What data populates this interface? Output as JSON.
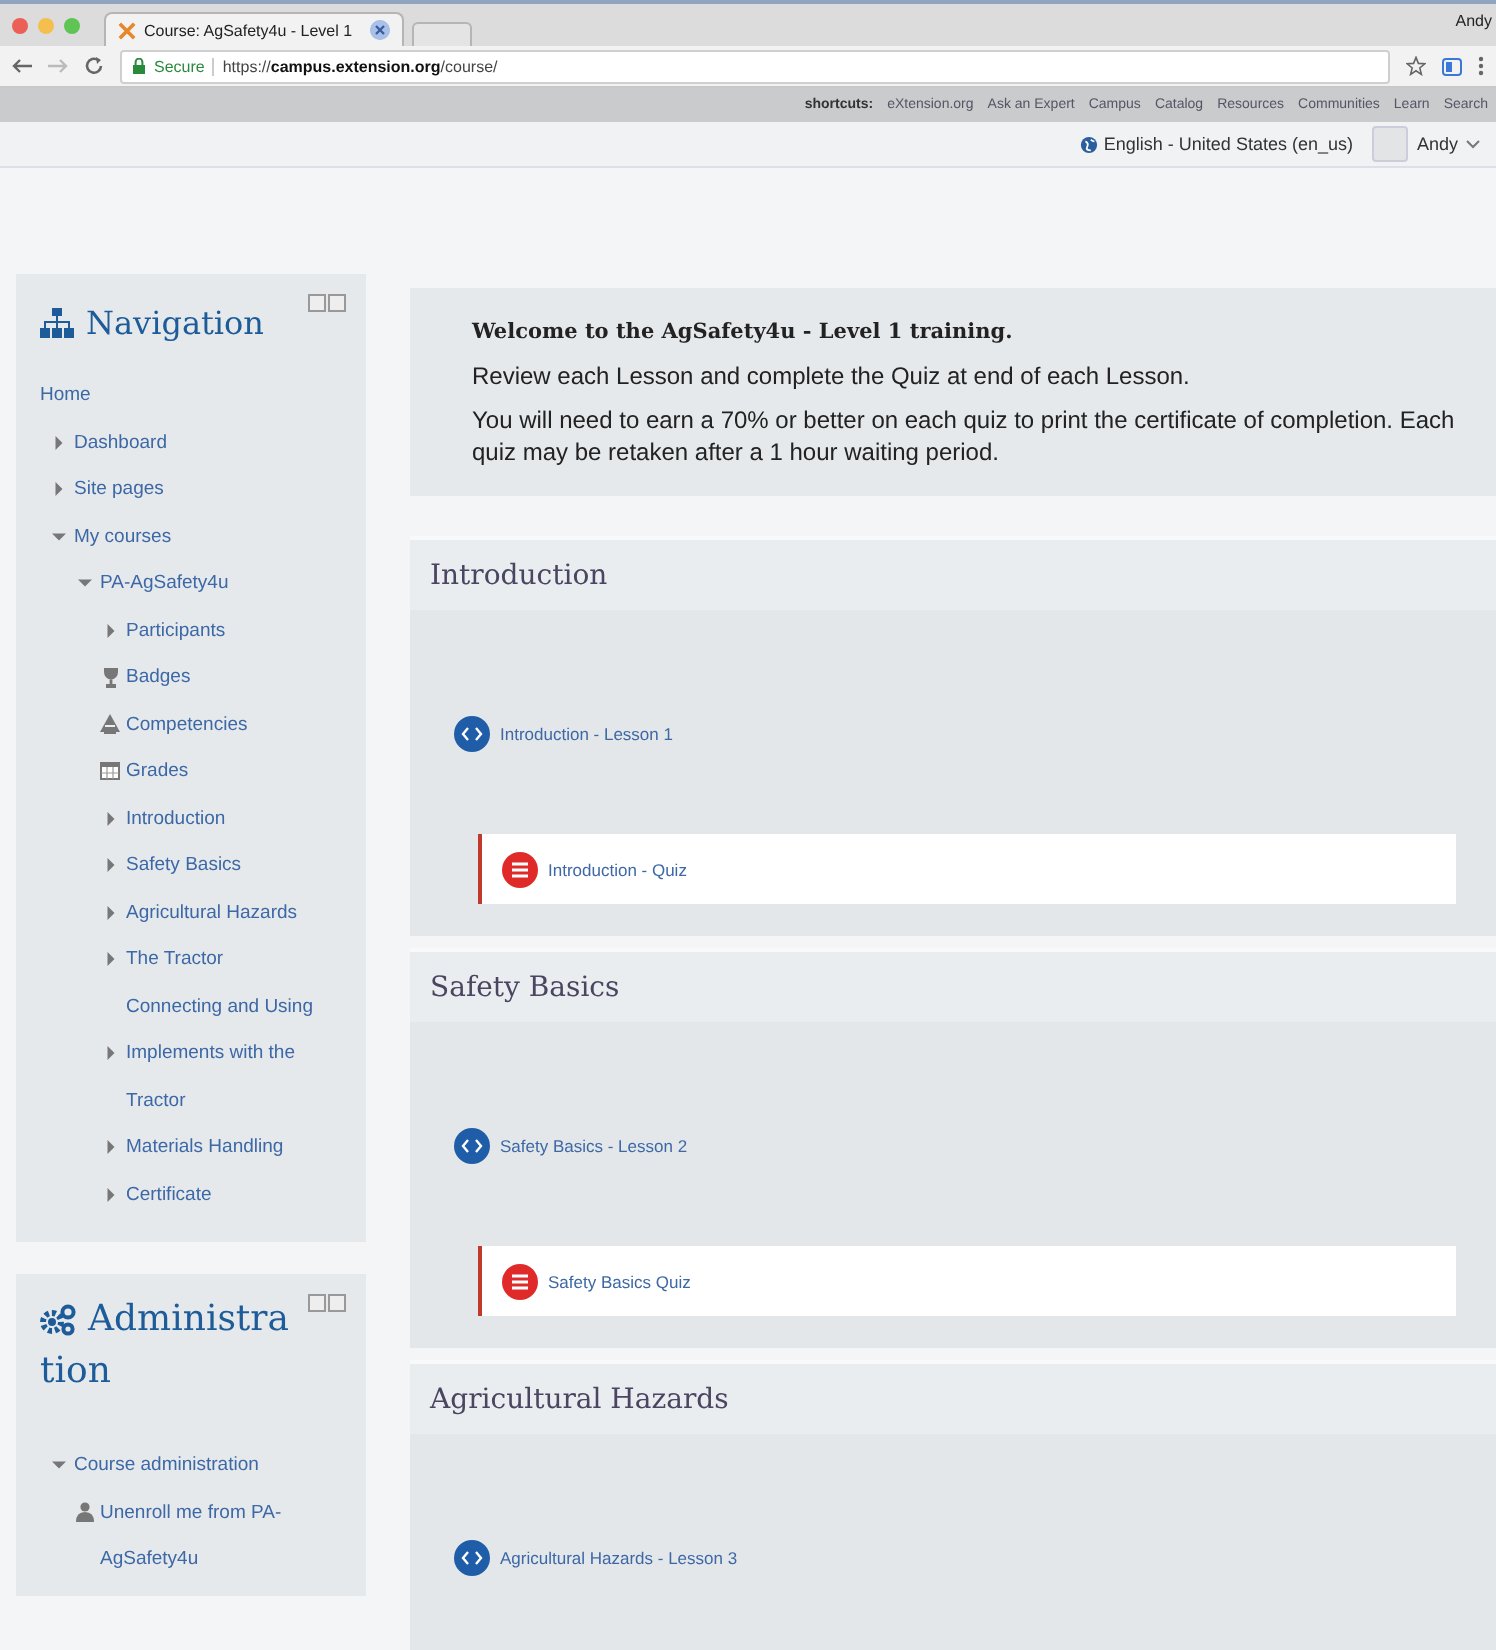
{
  "browser": {
    "tab_title": "Course: AgSafety4u - Level 1",
    "profile": "Andy",
    "secure_label": "Secure",
    "url": "https://**campus.extension.org**/course/"
  },
  "shortcuts": {
    "label": "shortcuts:",
    "links": [
      "eXtension.org",
      "Ask an Expert",
      "Campus",
      "Catalog",
      "Resources",
      "Communities",
      "Learn",
      "Search"
    ]
  },
  "user_bar": {
    "language": "English - United States (en_us)",
    "user": "Andy"
  },
  "navigation": {
    "title": "Navigation",
    "items": [
      {
        "kind": "link",
        "label": "Home"
      },
      {
        "kind": "node",
        "label": "Dashboard",
        "expanded": false
      },
      {
        "kind": "node",
        "label": "Site pages",
        "expanded": false
      },
      {
        "kind": "node",
        "label": "My courses",
        "expanded": true,
        "children": [
          {
            "kind": "node",
            "label": "PA-AgSafety4u",
            "expanded": true,
            "children": [
              {
                "kind": "node",
                "label": "Participants",
                "expanded": false
              },
              {
                "kind": "badge",
                "label": "Badges"
              },
              {
                "kind": "competency",
                "label": "Competencies"
              },
              {
                "kind": "grades",
                "label": "Grades"
              },
              {
                "kind": "node",
                "label": "Introduction",
                "expanded": false
              },
              {
                "kind": "node",
                "label": "Safety Basics",
                "expanded": false
              },
              {
                "kind": "node",
                "label": "Agricultural Hazards",
                "expanded": false
              },
              {
                "kind": "node",
                "label": "The Tractor",
                "expanded": false
              },
              {
                "kind": "text",
                "label": "Connecting and Using"
              },
              {
                "kind": "node",
                "label": "Implements with the Tractor",
                "expanded": false
              },
              {
                "kind": "node",
                "label": "Materials Handling",
                "expanded": false
              },
              {
                "kind": "node",
                "label": "Certificate",
                "expanded": false
              }
            ]
          }
        ]
      }
    ]
  },
  "administration": {
    "title_lines": [
      "Administra",
      "tion"
    ],
    "items": [
      {
        "kind": "node",
        "label": "Course administration",
        "expanded": true,
        "children": [
          {
            "kind": "user",
            "label": "Unenroll me from PA-AgSafety4u"
          }
        ]
      }
    ]
  },
  "welcome": {
    "heading": "Welcome to the AgSafety4u - Level 1 training.",
    "paragraphs": [
      "Review each Lesson and complete the Quiz at end of each Lesson.",
      "You will need to earn a 70% or better on each quiz to print the certificate of completion. Each quiz may be retaken after a 1 hour waiting period."
    ]
  },
  "sections": [
    {
      "title": "Introduction",
      "activities": [
        {
          "kind": "lesson",
          "label": "Introduction - Lesson 1"
        },
        {
          "kind": "quiz",
          "label": "Introduction - Quiz"
        }
      ]
    },
    {
      "title": "Safety Basics",
      "activities": [
        {
          "kind": "lesson",
          "label": "Safety Basics - Lesson 2"
        },
        {
          "kind": "quiz",
          "label": "Safety Basics Quiz"
        }
      ]
    },
    {
      "title": "Agricultural Hazards",
      "activities": [
        {
          "kind": "lesson",
          "label": "Agricultural Hazards - Lesson 3"
        }
      ]
    }
  ]
}
